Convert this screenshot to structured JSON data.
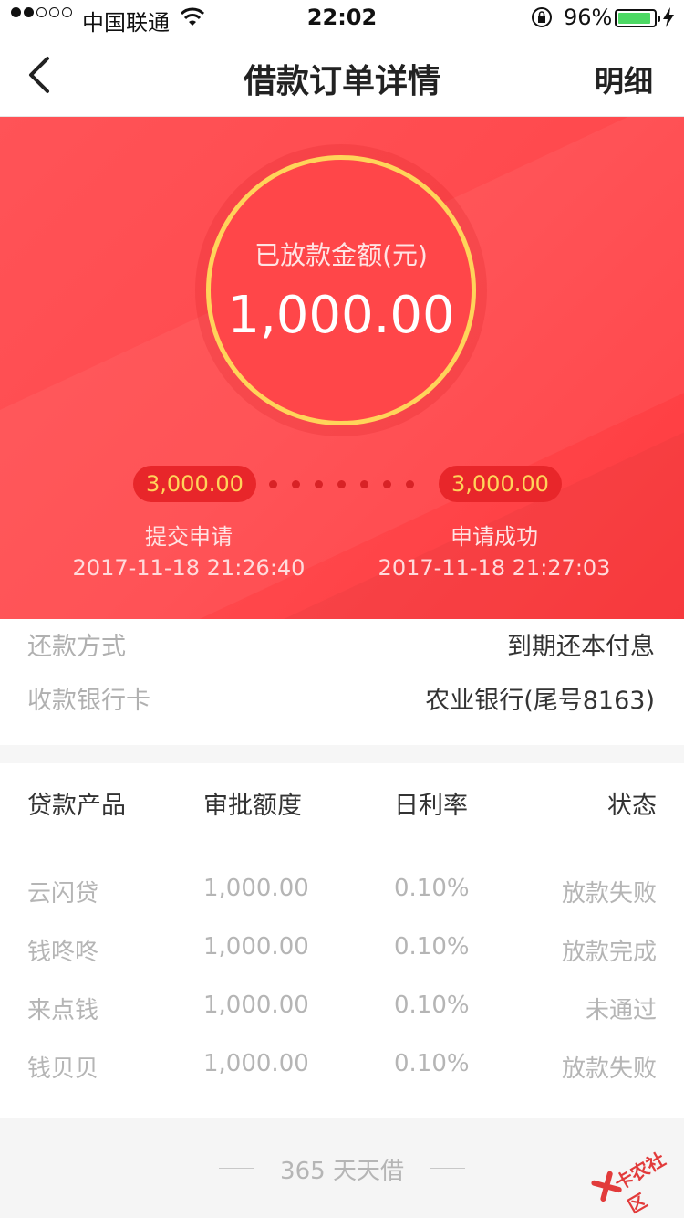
{
  "status_bar": {
    "carrier": "中国联通",
    "time": "22:02",
    "battery_percent": "96%",
    "battery_color": "#4cd964"
  },
  "nav": {
    "title": "借款订单详情",
    "detail_label": "明细"
  },
  "hero": {
    "label": "已放款金额(元)",
    "amount": "1,000.00",
    "ring_color": "#ffd45a",
    "steps": [
      {
        "amount": "3,000.00",
        "label": "提交申请",
        "time": "2017-11-18 21:26:40"
      },
      {
        "amount": "3,000.00",
        "label": "申请成功",
        "time": "2017-11-18 21:27:03"
      }
    ]
  },
  "info": [
    {
      "key": "还款方式",
      "value": "到期还本付息"
    },
    {
      "key": "收款银行卡",
      "value": "农业银行(尾号8163)"
    }
  ],
  "table": {
    "headers": [
      "贷款产品",
      "审批额度",
      "日利率",
      "状态"
    ],
    "rows": [
      [
        "云闪贷",
        "1,000.00",
        "0.10%",
        "放款失败"
      ],
      [
        "钱咚咚",
        "1,000.00",
        "0.10%",
        "放款完成"
      ],
      [
        "来点钱",
        "1,000.00",
        "0.10%",
        "未通过"
      ],
      [
        "钱贝贝",
        "1,000.00",
        "0.10%",
        "放款失败"
      ]
    ]
  },
  "footer": {
    "brand": "365 天天借"
  },
  "watermark": {
    "text": "卡农社区"
  }
}
